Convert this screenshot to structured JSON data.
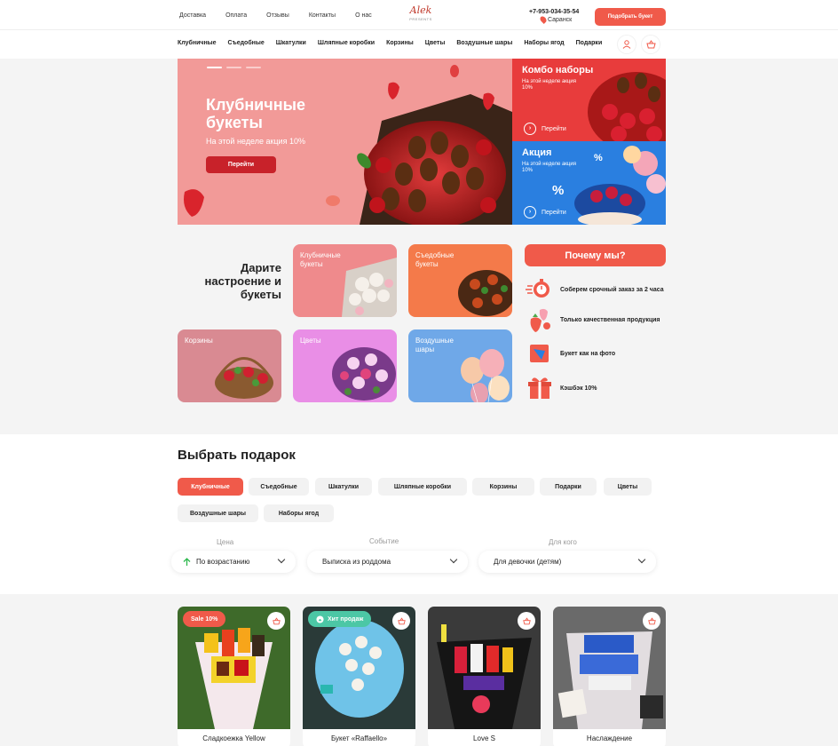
{
  "topnav": [
    "Доставка",
    "Оплата",
    "Отзывы",
    "Контакты",
    "О нас"
  ],
  "logo": {
    "line1": "Alek",
    "line2": "PRESENTS"
  },
  "phone": "+7-953-034-35-54",
  "city": "Саранск",
  "pick_button": "Подобрать букет",
  "catnav": [
    "Клубничные",
    "Съедобные",
    "Шкатулки",
    "Шляпные коробки",
    "Корзины",
    "Цветы",
    "Воздушные шары",
    "Наборы ягод",
    "Подарки"
  ],
  "hero": {
    "title": "Клубничные букеты",
    "subtitle": "На этой неделе акция 10%",
    "button": "Перейти"
  },
  "side1": {
    "title": "Комбо наборы",
    "sub": "На этой неделе акция 10%",
    "link": "Перейти"
  },
  "side2": {
    "title": "Акция",
    "sub": "На этой неделе акция 10%",
    "link": "Перейти"
  },
  "gifts_title": "Дарите настроение и букеты",
  "tiles": [
    "Клубничные букеты",
    "Съедобные букеты",
    "Корзины",
    "Цветы",
    "Воздушные шары"
  ],
  "why": {
    "title": "Почему мы?",
    "items": [
      "Соберем срочный заказ за 2 часа",
      "Только качественная продукция",
      "Букет как на фото",
      "Кэшбэк 10%"
    ]
  },
  "choose": {
    "title": "Выбрать подарок",
    "chips": [
      "Клубничные",
      "Съедобные",
      "Шкатулки",
      "Шляпные коробки",
      "Корзины",
      "Подарки",
      "Цветы",
      "Воздушные шары",
      "Наборы ягод"
    ]
  },
  "filters": {
    "price_label": "Цена",
    "price_value": "По возрастанию",
    "event_label": "Событие",
    "event_value": "Выписка из роддома",
    "for_label": "Для кого",
    "for_value": "Для девочки (детям)"
  },
  "products": [
    {
      "name": "Сладкоежка Yellow",
      "badge": "Sale  10%"
    },
    {
      "name": "Букет «Raffaello»",
      "badge": "Хит продаж"
    },
    {
      "name": "Love S",
      "badge": ""
    },
    {
      "name": "Наслаждение",
      "badge": ""
    }
  ],
  "colors": {
    "accent": "#f05a4a",
    "hero_bg": "#f29a98",
    "promo_red": "#e83c3c",
    "promo_blue": "#2a7fe0",
    "hit_green": "#4cc7a5"
  }
}
